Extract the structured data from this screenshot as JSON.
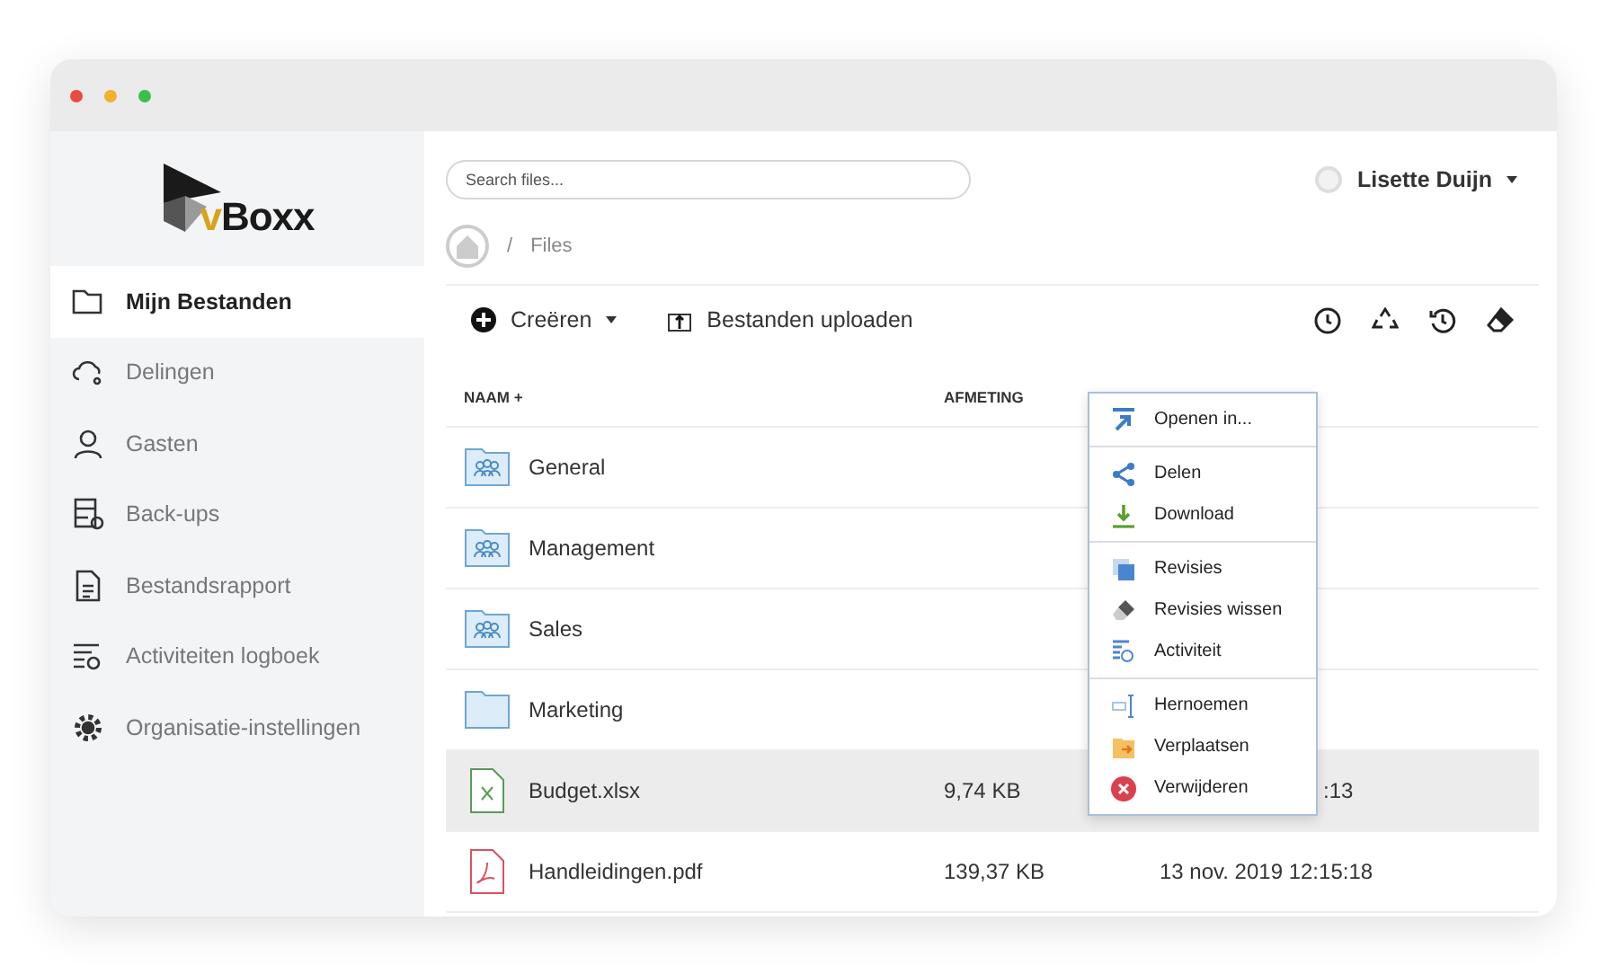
{
  "logo": {
    "text": "Boxx",
    "accent": "v"
  },
  "sidebar": {
    "items": [
      {
        "label": "Mijn Bestanden",
        "selected": true
      },
      {
        "label": "Delingen",
        "selected": false
      },
      {
        "label": "Gasten",
        "selected": false
      },
      {
        "label": "Back-ups",
        "selected": false
      },
      {
        "label": "Bestandsrapport",
        "selected": false
      },
      {
        "label": "Activiteiten logboek",
        "selected": false
      },
      {
        "label": "Organisatie-instellingen",
        "selected": false
      }
    ]
  },
  "search": {
    "placeholder": "Search files..."
  },
  "user": {
    "name": "Lisette Duijn"
  },
  "breadcrumb": [
    "/",
    "Files"
  ],
  "toolbar": {
    "create": "Creëren",
    "upload": "Bestanden uploaden"
  },
  "table": {
    "columns": [
      "NAAM +",
      "AFMETING"
    ],
    "rows": [
      {
        "kind": "team-folder",
        "name": "General",
        "selected": false
      },
      {
        "kind": "team-folder",
        "name": "Management",
        "selected": false
      },
      {
        "kind": "team-folder",
        "name": "Sales",
        "selected": false
      },
      {
        "kind": "folder",
        "name": "Marketing",
        "selected": false
      },
      {
        "kind": "spreadsheet",
        "name": "Budget.xlsx",
        "size": "9,74 KB",
        "date": ":13",
        "selected": true
      },
      {
        "kind": "pdf",
        "name": "Handleidingen.pdf",
        "size": "139,37 KB",
        "date": "13 nov. 2019 12:15:18",
        "selected": false
      }
    ]
  },
  "context_menu": {
    "groups": [
      [
        "Openen in..."
      ],
      [
        "Delen",
        "Download"
      ],
      [
        "Revisies",
        "Revisies wissen",
        "Activiteit"
      ],
      [
        "Hernoemen",
        "Verplaatsen",
        "Verwijderen"
      ]
    ]
  }
}
